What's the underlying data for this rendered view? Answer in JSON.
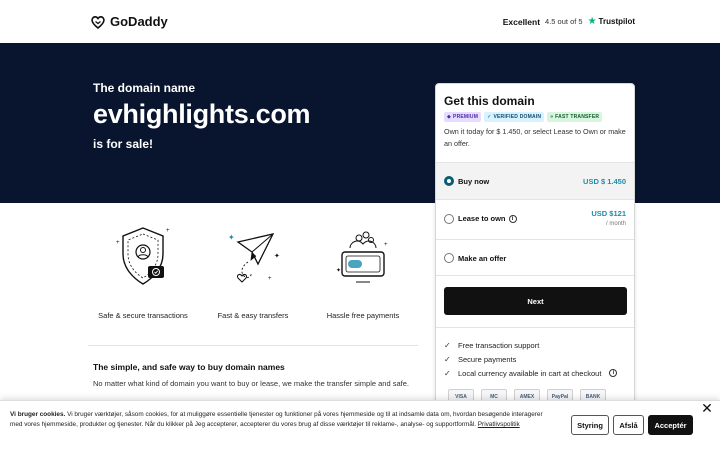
{
  "header": {
    "logo_text": "GoDaddy",
    "trust_label": "Excellent",
    "trust_rating": "4.5 out of 5",
    "trust_brand": "Trustpilot"
  },
  "hero": {
    "pre_text": "The domain name",
    "domain": "evhighlights.com",
    "post_text": "is for sale!"
  },
  "features": [
    {
      "label": "Safe & secure transactions",
      "icon": "shield-icon"
    },
    {
      "label": "Fast & easy transfers",
      "icon": "paper-plane-icon"
    },
    {
      "label": "Hassle free payments",
      "icon": "money-icon"
    }
  ],
  "info": {
    "title": "The simple, and safe way to buy domain names",
    "text": "No matter what kind of domain you want to buy or lease, we make the transfer simple and safe."
  },
  "card": {
    "title": "Get this domain",
    "badges": [
      "PREMIUM",
      "VERIFIED DOMAIN",
      "FAST TRANSFER"
    ],
    "own_text": "Own it today for $ 1.450, or select Lease to Own or make an offer.",
    "options": [
      {
        "label": "Buy now",
        "price": "USD $ 1.450",
        "selected": true
      },
      {
        "label": "Lease to own",
        "price": "USD $121",
        "per": "/ month",
        "selected": false
      },
      {
        "label": "Make an offer",
        "selected": false
      }
    ],
    "next_label": "Next",
    "checks": [
      "Free transaction support",
      "Secure payments",
      "Local currency available in cart at checkout"
    ],
    "payment_methods": [
      "VISA",
      "MC",
      "AMEX",
      "PayPal",
      "BANK"
    ],
    "accent_color": "#1a8fad"
  },
  "cookie": {
    "heading": "Vi bruger cookies.",
    "text": "Vi bruger værktøjer, såsom cookies, for at muliggøre essentielle tjenester og funktioner på vores hjemmeside og til at indsamle data om, hvordan besøgende interagerer med vores hjemmeside, produkter og tjenester. Når du klikker på Jeg accepterer, accepterer du vores brug af disse værktøjer til reklame-, analyse- og supportformål.",
    "link": "Privatlivspolitik",
    "buttons": {
      "settings": "Styring",
      "decline": "Afslå",
      "accept": "Acceptér"
    },
    "close": "✕"
  }
}
